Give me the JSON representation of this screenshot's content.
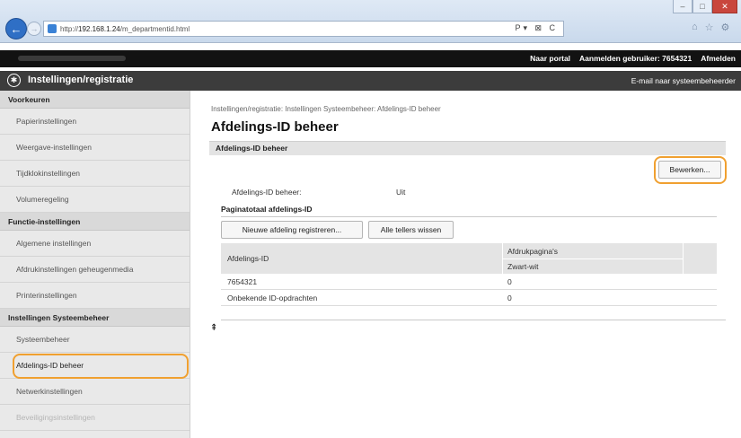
{
  "browser": {
    "url_prefix": "http://",
    "url_host": "192.168.1.24",
    "url_path": "/m_departmentid.html",
    "address_icons": "P▾ ⊠ C",
    "window_controls": [
      "–",
      "□",
      "✕"
    ]
  },
  "header": {
    "portal_link": "Naar portal",
    "login_label": "Aanmelden gebruiker:",
    "login_user": "7654321",
    "logout_link": "Afmelden",
    "title": "Instellingen/registratie",
    "mail_link": "E-mail naar systeembeheerder"
  },
  "sidebar": {
    "sections": [
      {
        "heading": "Voorkeuren",
        "items": [
          "Papierinstellingen",
          "Weergave-instellingen",
          "Tijdklokinstellingen",
          "Volumeregeling"
        ]
      },
      {
        "heading": "Functie-instellingen",
        "items": [
          "Algemene instellingen",
          "Afdrukinstellingen geheugenmedia",
          "Printerinstellingen"
        ]
      },
      {
        "heading": "Instellingen Systeembeheer",
        "items": [
          "Systeembeheer",
          "Afdelings-ID beheer",
          "Netwerkinstellingen",
          "Beveiligingsinstellingen"
        ]
      }
    ]
  },
  "main": {
    "breadcrumb": "Instellingen/registratie: Instellingen Systeembeheer: Afdelings-ID beheer",
    "title": "Afdelings-ID beheer",
    "section_title": "Afdelings-ID beheer",
    "edit_button": "Bewerken...",
    "setting_label": "Afdelings-ID beheer:",
    "setting_value": "Uit",
    "counter_heading": "Paginatotaal afdelings-ID",
    "register_button": "Nieuwe afdeling registreren...",
    "clear_button": "Alle tellers wissen",
    "table": {
      "col_id": "Afdelings-ID",
      "col_pages": "Afdrukpagina's",
      "col_bw": "Zwart-wit",
      "rows": [
        {
          "id": "7654321",
          "bw": "0"
        },
        {
          "id": "Onbekende ID-opdrachten",
          "bw": "0"
        }
      ]
    },
    "to_top_icon": "⇞"
  }
}
